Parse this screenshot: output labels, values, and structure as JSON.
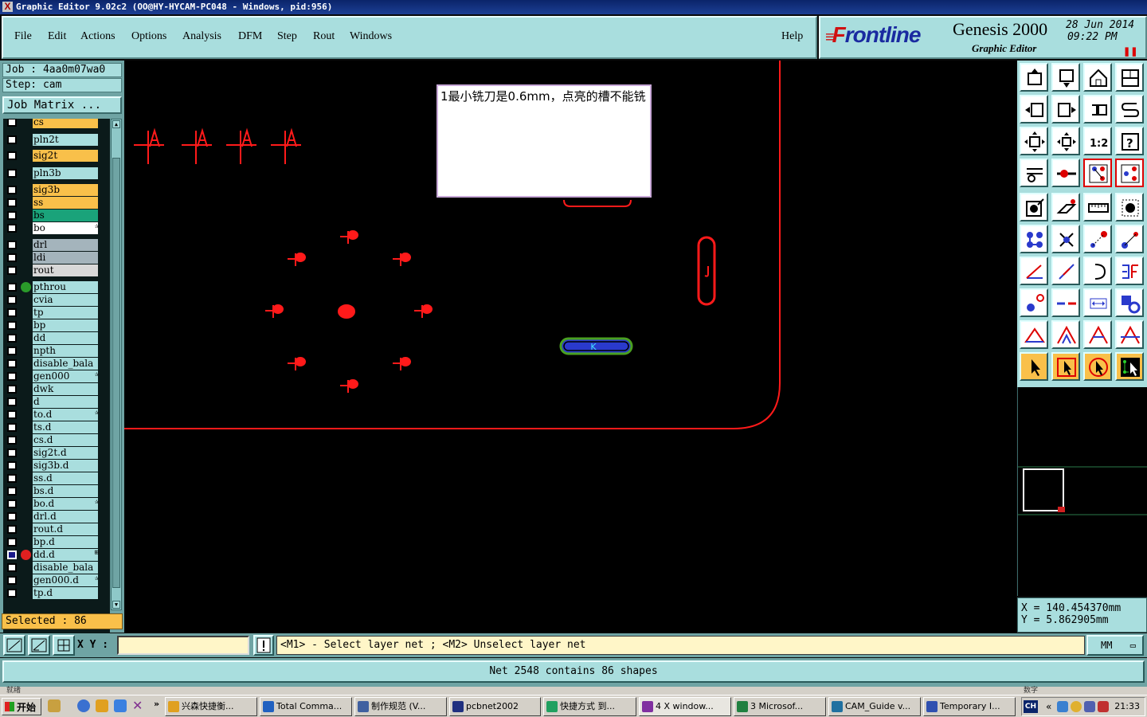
{
  "title_bar": {
    "text": "Graphic Editor 9.02c2 (OO@HY-HYCAM-PC048 - Windows, pid:956)"
  },
  "menu": {
    "file": "File",
    "edit": "Edit",
    "actions": "Actions",
    "options": "Options",
    "analysis": "Analysis",
    "dfm": "DFM",
    "step": "Step",
    "rout": "Rout",
    "windows": "Windows",
    "help": "Help"
  },
  "brand": {
    "logo_f": "F",
    "logo_rest": "rontline",
    "product": "Genesis 2000",
    "subtitle": "Graphic Editor",
    "date": "28 Jun 2014",
    "time": "09:22 PM"
  },
  "job": {
    "job": "Job : 4aa0m07wa0",
    "step": "Step: cam",
    "matrix_button": "Job Matrix ..."
  },
  "layers": [
    {
      "name": "cs",
      "color": "#f9c04a"
    },
    {
      "name": "pln2t",
      "color": "#a9dede"
    },
    {
      "name": "sig2t",
      "color": "#f9c04a"
    },
    {
      "name": "pln3b",
      "color": "#a9dede"
    },
    {
      "name": "sig3b",
      "color": "#f9c04a"
    },
    {
      "name": "ss",
      "color": "#f9c04a"
    },
    {
      "name": "bs",
      "color": "#1aa37a"
    },
    {
      "name": "bo",
      "color": "#ffffff",
      "mark": "✰"
    },
    {
      "name": "drl",
      "color": "#a4b4bc"
    },
    {
      "name": "ldi",
      "color": "#a4b4bc"
    },
    {
      "name": "rout",
      "color": "#d8d8d8"
    },
    {
      "name": "pthrou",
      "color": "#a9dede",
      "dot": true
    },
    {
      "name": "cvia",
      "color": "#a9dede"
    },
    {
      "name": "tp",
      "color": "#a9dede"
    },
    {
      "name": "bp",
      "color": "#a9dede"
    },
    {
      "name": "dd",
      "color": "#a9dede"
    },
    {
      "name": "npth",
      "color": "#a9dede"
    },
    {
      "name": "disable_bala",
      "color": "#a9dede"
    },
    {
      "name": "gen000",
      "color": "#a9dede",
      "mark": "✰"
    },
    {
      "name": "dwk",
      "color": "#a9dede"
    },
    {
      "name": "d",
      "color": "#a9dede"
    },
    {
      "name": "to.d",
      "color": "#a9dede",
      "mark": "✰"
    },
    {
      "name": "ts.d",
      "color": "#a9dede"
    },
    {
      "name": "cs.d",
      "color": "#a9dede"
    },
    {
      "name": "sig2t.d",
      "color": "#a9dede"
    },
    {
      "name": "sig3b.d",
      "color": "#a9dede"
    },
    {
      "name": "ss.d",
      "color": "#a9dede"
    },
    {
      "name": "bs.d",
      "color": "#a9dede"
    },
    {
      "name": "bo.d",
      "color": "#a9dede",
      "mark": "✰"
    },
    {
      "name": "drl.d",
      "color": "#a9dede"
    },
    {
      "name": "rout.d",
      "color": "#a9dede"
    },
    {
      "name": "bp.d",
      "color": "#a9dede"
    },
    {
      "name": "dd.d",
      "color": "#a9dede",
      "active": true,
      "mark": "⊞"
    },
    {
      "name": "disable_bala",
      "color": "#a9dede"
    },
    {
      "name": "gen000.d",
      "color": "#a9dede",
      "mark": "✰"
    },
    {
      "name": "tp.d",
      "color": "#a9dede"
    }
  ],
  "selected": "Selected : 86",
  "note": {
    "text": "1最小铣刀是0.6mm，点亮的槽不能铣"
  },
  "coords": {
    "x": "X = 140.454370mm",
    "y": "Y = 5.862905mm"
  },
  "command": {
    "xy_label": "X Y :",
    "xy_value": "",
    "prompt": "<M1> - Select layer net ; <M2> Unselect layer net",
    "units": "MM"
  },
  "status": "Net 2548 contains 86 shapes",
  "sliver": {
    "left": "就绪",
    "right": "数字"
  },
  "taskbar": {
    "start": "开始",
    "tasks": [
      "兴森快捷衡...",
      "Total Comma...",
      "制作规范 (V...",
      "pcbnet2002",
      "快捷方式 到...",
      "4 X window...",
      "3 Microsof...",
      "CAM_Guide v...",
      "Temporary I..."
    ],
    "ime": "CH",
    "clock": "21:33"
  },
  "colors": {
    "feature": "#ff1a1a",
    "highlight_outline": "#4aa020",
    "highlight_inner": "#2a3acc",
    "panel": "#a9dede",
    "selected_bg": "#f9c04a"
  }
}
